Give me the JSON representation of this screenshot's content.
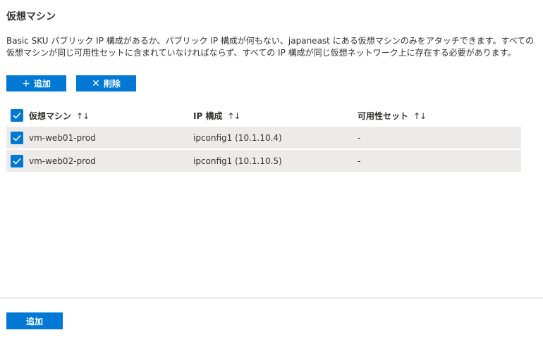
{
  "section": {
    "title": "仮想マシン",
    "description": "Basic SKU パブリック IP 構成があるか、パブリック IP 構成が何もない、japaneast にある仮想マシンのみをアタッチできます。すべての仮想マシンが同じ可用性セットに含まれていなければならず、すべての IP 構成が同じ仮想ネットワーク上に存在する必要があります。"
  },
  "toolbar": {
    "add_label": "追加",
    "delete_label": "削除"
  },
  "table": {
    "columns": {
      "vm": "仮想マシン",
      "ip": "IP 構成",
      "availability": "可用性セット"
    },
    "sort_glyph": "↑↓",
    "rows": [
      {
        "vm": "vm-web01-prod",
        "ip": "ipconfig1 (10.1.10.4)",
        "availability": "-",
        "checked": true
      },
      {
        "vm": "vm-web02-prod",
        "ip": "ipconfig1 (10.1.10.5)",
        "availability": "-",
        "checked": true
      }
    ]
  },
  "footer": {
    "add_label": "追加"
  },
  "colors": {
    "accent": "#0078d4",
    "row_background": "#edebe9",
    "divider": "#c8c6c4"
  }
}
